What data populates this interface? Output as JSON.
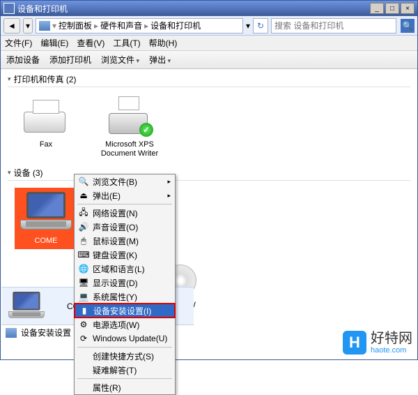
{
  "titlebar": {
    "title": "设备和打印机"
  },
  "winbtns": {
    "min": "_",
    "max": "□",
    "close": "×"
  },
  "breadcrumb": {
    "seg1": "控制面板",
    "seg2": "硬件和声音",
    "seg3": "设备和打印机",
    "sep": "▸"
  },
  "search": {
    "placeholder": "搜索 设备和打印机"
  },
  "menubar": {
    "file": "文件(F)",
    "edit": "编辑(E)",
    "view": "查看(V)",
    "tools": "工具(T)",
    "help": "帮助(H)"
  },
  "toolbar": {
    "addDevice": "添加设备",
    "addPrinter": "添加打印机",
    "browse": "浏览文件",
    "eject": "弹出"
  },
  "group1": {
    "label": "打印机和传真 (2)"
  },
  "group2": {
    "label": "设备 (3)"
  },
  "items": {
    "fax": "Fax",
    "xps": "Microsoft XPS Document Writer",
    "come": "COME",
    "crw": ".0-CRW"
  },
  "context": {
    "browse": "浏览文件(B)",
    "eject": "弹出(E)",
    "network": "网络设置(N)",
    "sound": "声音设置(O)",
    "mouse": "鼠标设置(M)",
    "keyboard": "键盘设置(K)",
    "region": "区域和语言(L)",
    "display": "显示设置(D)",
    "system": "系统属性(Y)",
    "devinstall": "设备安装设置(I)",
    "power": "电源选项(W)",
    "winupdate": "Windows Update(U)",
    "shortcut": "创建快捷方式(S)",
    "troubleshoot": "疑难解答(T)",
    "properties": "属性(R)"
  },
  "preview": {
    "label": "COM"
  },
  "status": {
    "text": "设备安装设置"
  },
  "watermark": {
    "logo": "H",
    "text1": "好特网",
    "text2": "haote.com"
  }
}
